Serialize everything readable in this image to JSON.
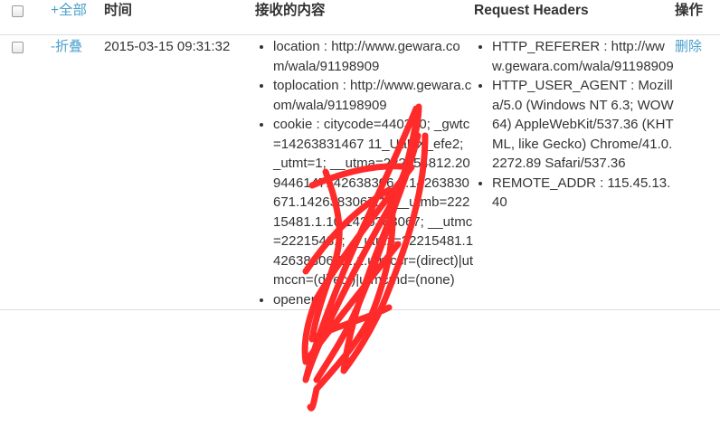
{
  "headers": {
    "select_all": "+全部",
    "time": "时间",
    "content": "接收的内容",
    "request_headers": "Request Headers",
    "action": "操作"
  },
  "row": {
    "toggle": "-折叠",
    "time": "2015-03-15 09:31:32",
    "content": [
      "location : http://www.gewara.com/wala/91198909",
      "toplocation : http://www.gewara.com/wala/91198909",
      "cookie : citycode=440300; _gwtc=14263831467 11_UaUX_efe2; _utmt=1; __utma=222154812.209446147142638306 7.14263830671.1426383067.1; __utmb=22215481.1.10.1426383067; __utmc=22215481; __utmz=22215481.1426383067.1.1.utmcsr=(direct)|utmccn=(direct)|utmcmd=(none)",
      "opener :"
    ],
    "headers": [
      "HTTP_REFERER : http://www.gewara.com/wala/91198909",
      "HTTP_USER_AGENT : Mozilla/5.0 (Windows NT 6.3; WOW64) AppleWebKit/537.36 (KHTML, like Gecko) Chrome/41.0.2272.89 Safari/537.36",
      "REMOTE_ADDR : 115.45.13.40"
    ],
    "delete": "删除"
  },
  "colors": {
    "link": "#4aa0cc",
    "scribble": "#ff2a2a",
    "border": "#dddddd"
  }
}
